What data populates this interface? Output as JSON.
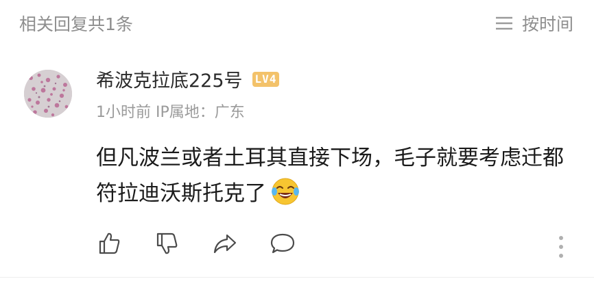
{
  "header": {
    "title": "相关回复共1条",
    "sort_label": "按时间"
  },
  "comment": {
    "username": "希波克拉底225号",
    "level": "LV4",
    "time": "1小时前",
    "ip_location": "IP属地：广东",
    "text": "但凡波兰或者土耳其直接下场，毛子就要考虑迁都符拉迪沃斯托克了",
    "emoji": "laughing-crying-emoji"
  },
  "actions": {
    "icons": [
      "thumbs-up-icon",
      "thumbs-down-icon",
      "share-icon",
      "comment-icon",
      "more-icon"
    ]
  },
  "colors": {
    "muted_text": "#8e8e8e",
    "body_text": "#1b1b1b",
    "level_badge": "#f3c26a"
  }
}
